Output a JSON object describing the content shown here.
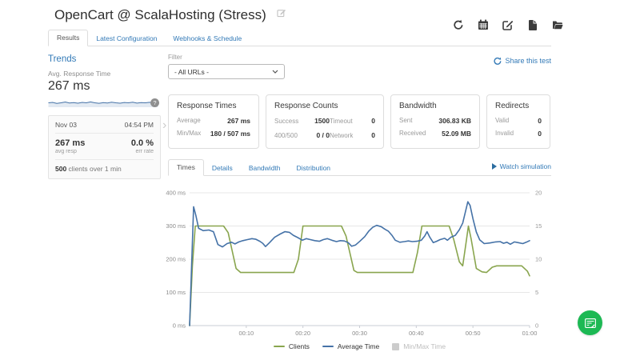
{
  "header": {
    "title": "OpenCart @ ScalaHosting (Stress)",
    "toolbar_icons": [
      "refresh",
      "calendar",
      "edit",
      "report",
      "open-folder"
    ]
  },
  "nav_tabs": {
    "items": [
      {
        "label": "Results",
        "active": true
      },
      {
        "label": "Latest Configuration",
        "active": false
      },
      {
        "label": "Webhooks & Schedule",
        "active": false
      }
    ]
  },
  "sidebar": {
    "trends_label": "Trends",
    "metric_label": "Avg. Response Time",
    "metric_value": "267 ms",
    "help_badge": "?",
    "sparkline": [
      0.5,
      0.56,
      0.42,
      0.5,
      0.61,
      0.48,
      0.53,
      0.44,
      0.55,
      0.5,
      0.62,
      0.5,
      0.43,
      0.52,
      0.48,
      0.58,
      0.5,
      0.45,
      0.54,
      0.5,
      0.59,
      0.46,
      0.52,
      0.5,
      0.57,
      0.47,
      0.52
    ],
    "trend_card": {
      "date": "Nov 03",
      "time": "04:54 PM",
      "avg_value": "267 ms",
      "avg_caption": "avg resp",
      "err_value": "0.0 %",
      "err_caption": "err rate",
      "clients_bold": "500",
      "clients_rest": " clients over 1 min"
    },
    "next_chevron": "›"
  },
  "filter": {
    "label": "Filter",
    "selected": "- All URLs -"
  },
  "share_link": {
    "label": "Share this test"
  },
  "stats_cards": [
    {
      "title": "Response Times",
      "rows": [
        {
          "label": "Average",
          "value": "267 ms"
        },
        {
          "label": "Min/Max",
          "value": "180 / 507 ms"
        }
      ]
    },
    {
      "title": "Response Counts",
      "rows": [
        {
          "label": "Success",
          "value": "1500",
          "label2": "Timeout",
          "value2": "0"
        },
        {
          "label": "400/500",
          "value": "0 / 0",
          "label2": "Network",
          "value2": "0"
        }
      ]
    },
    {
      "title": "Bandwidth",
      "rows": [
        {
          "label": "Sent",
          "value": "306.83 KB"
        },
        {
          "label": "Received",
          "value": "52.09 MB"
        }
      ]
    },
    {
      "title": "Redirects",
      "rows": [
        {
          "label": "Valid",
          "value": "0"
        },
        {
          "label": "Invalid",
          "value": "0"
        }
      ]
    }
  ],
  "chart_tabs": {
    "items": [
      {
        "label": "Times",
        "active": true
      },
      {
        "label": "Details",
        "active": false
      },
      {
        "label": "Bandwidth",
        "active": false
      },
      {
        "label": "Distribution",
        "active": false
      }
    ],
    "watch_label": "Watch simulation"
  },
  "chart_data": {
    "type": "line",
    "title": "",
    "x_axis": {
      "range_seconds": [
        0,
        60
      ],
      "ticks": [
        "00:10",
        "00:20",
        "00:30",
        "00:40",
        "00:50",
        "01:00"
      ],
      "tick_seconds": [
        10,
        20,
        30,
        40,
        50,
        60
      ]
    },
    "y_left": {
      "range": [
        0,
        400
      ],
      "tick_values": [
        0,
        100,
        200,
        300,
        400
      ],
      "labels": [
        "0 ms",
        "100 ms",
        "200 ms",
        "300 ms",
        "400 ms"
      ]
    },
    "y_right": {
      "range": [
        0,
        20
      ],
      "labels": [
        "0",
        "5",
        "10",
        "15",
        "20"
      ]
    },
    "grid": true,
    "legend": [
      {
        "name": "Clients",
        "color": "#89A54E",
        "symbol": "line",
        "disabled": false
      },
      {
        "name": "Average Time",
        "color": "#4572A7",
        "symbol": "line",
        "disabled": false
      },
      {
        "name": "Min/Max Time",
        "color": "#CCCCCC",
        "symbol": "square",
        "disabled": true
      }
    ],
    "series": [
      {
        "name": "Clients",
        "axis": "right",
        "color": "#89A54E",
        "points": [
          [
            0,
            0
          ],
          [
            0.5,
            9
          ],
          [
            1,
            15
          ],
          [
            6,
            15
          ],
          [
            6.8,
            14
          ],
          [
            8.2,
            8.6
          ],
          [
            9,
            8
          ],
          [
            18.4,
            8
          ],
          [
            19.2,
            10
          ],
          [
            20,
            15
          ],
          [
            26.8,
            15
          ],
          [
            27.6,
            13.5
          ],
          [
            29,
            8.3
          ],
          [
            29.6,
            8
          ],
          [
            39.4,
            8
          ],
          [
            40.2,
            11
          ],
          [
            41,
            15
          ],
          [
            45.8,
            15
          ],
          [
            46.6,
            13
          ],
          [
            47.6,
            9.6
          ],
          [
            48.2,
            9
          ],
          [
            48.7,
            12
          ],
          [
            49.2,
            15
          ],
          [
            49.7,
            13
          ],
          [
            50.6,
            8.6
          ],
          [
            51.6,
            8.1
          ],
          [
            52.4,
            8
          ],
          [
            53.4,
            8.8
          ],
          [
            54.2,
            9
          ],
          [
            58.6,
            9
          ],
          [
            59.6,
            8.2
          ],
          [
            60,
            7.5
          ]
        ]
      },
      {
        "name": "Average Time",
        "axis": "left",
        "color": "#4572A7",
        "points": [
          [
            0,
            0
          ],
          [
            0.7,
            358
          ],
          [
            1.1,
            332
          ],
          [
            1.6,
            293
          ],
          [
            2.4,
            286
          ],
          [
            3.4,
            288
          ],
          [
            4.2,
            283
          ],
          [
            5,
            244
          ],
          [
            5.8,
            237
          ],
          [
            6.6,
            247
          ],
          [
            7.4,
            251
          ],
          [
            8,
            246
          ],
          [
            8.7,
            252
          ],
          [
            9.4,
            256
          ],
          [
            10.2,
            259
          ],
          [
            11,
            262
          ],
          [
            11.7,
            260
          ],
          [
            12.4,
            254
          ],
          [
            12.9,
            248
          ],
          [
            13.4,
            238
          ],
          [
            14.1,
            250
          ],
          [
            15,
            266
          ],
          [
            16,
            276
          ],
          [
            16.8,
            283
          ],
          [
            17.6,
            281
          ],
          [
            18.3,
            272
          ],
          [
            19.1,
            265
          ],
          [
            19.9,
            257
          ],
          [
            20.6,
            262
          ],
          [
            21.3,
            259
          ],
          [
            22.1,
            256
          ],
          [
            22.9,
            254
          ],
          [
            23.6,
            259
          ],
          [
            24.3,
            262
          ],
          [
            25.1,
            257
          ],
          [
            25.9,
            253
          ],
          [
            26.6,
            256
          ],
          [
            27.3,
            255
          ],
          [
            28,
            250
          ],
          [
            28.6,
            239
          ],
          [
            29.3,
            243
          ],
          [
            30.1,
            255
          ],
          [
            30.9,
            268
          ],
          [
            31.6,
            284
          ],
          [
            32.3,
            296
          ],
          [
            33,
            302
          ],
          [
            33.8,
            298
          ],
          [
            34.5,
            290
          ],
          [
            35.1,
            284
          ],
          [
            35.7,
            272
          ],
          [
            36.3,
            257
          ],
          [
            37.1,
            251
          ],
          [
            37.9,
            253
          ],
          [
            38.6,
            255
          ],
          [
            39.3,
            253
          ],
          [
            40.1,
            254
          ],
          [
            40.9,
            257
          ],
          [
            41.5,
            270
          ],
          [
            41.9,
            283
          ],
          [
            42.4,
            266
          ],
          [
            43,
            250
          ],
          [
            43.6,
            254
          ],
          [
            44.2,
            259
          ],
          [
            45,
            263
          ],
          [
            45.5,
            257
          ],
          [
            46.1,
            266
          ],
          [
            46.9,
            272
          ],
          [
            47.6,
            289
          ],
          [
            48.2,
            309
          ],
          [
            48.8,
            352
          ],
          [
            49.1,
            373
          ],
          [
            49.5,
            362
          ],
          [
            50,
            322
          ],
          [
            50.6,
            282
          ],
          [
            51.2,
            258
          ],
          [
            52,
            247
          ],
          [
            53,
            249
          ],
          [
            54,
            252
          ],
          [
            54.8,
            253
          ],
          [
            55.4,
            248
          ],
          [
            56,
            251
          ],
          [
            56.6,
            245
          ],
          [
            57.3,
            252
          ],
          [
            58,
            250
          ],
          [
            58.8,
            247
          ],
          [
            59.4,
            251
          ],
          [
            60,
            256
          ]
        ]
      }
    ]
  },
  "colors": {
    "accent_blue": "#337ab7",
    "series_blue": "#4572A7",
    "series_olive": "#89A54E",
    "chat_green": "#1db954"
  }
}
